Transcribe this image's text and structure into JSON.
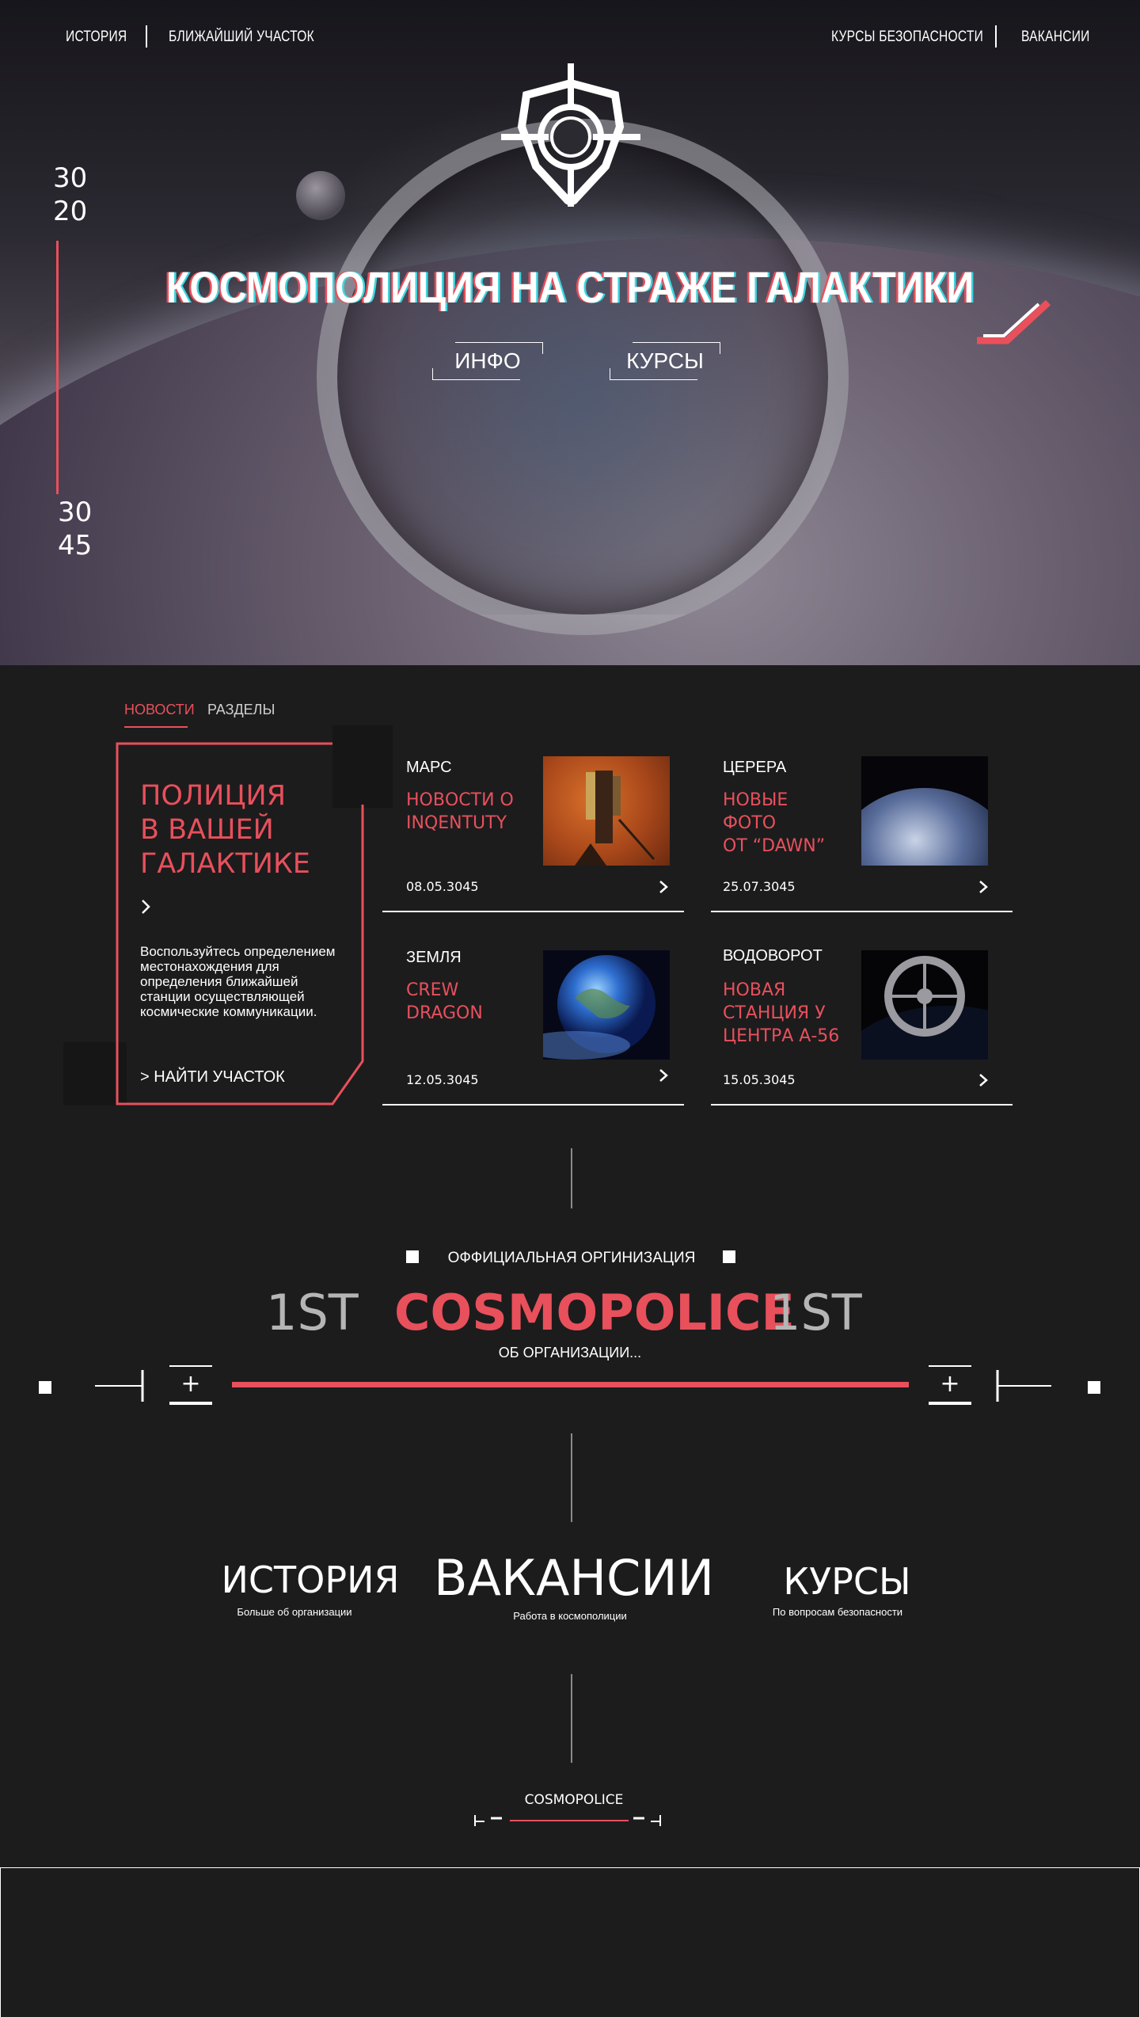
{
  "nav": {
    "left": [
      "ИСТОРИЯ",
      "БЛИЖАЙШИЙ УЧАСТОК"
    ],
    "right": [
      "КУРСЫ БЕЗОПАСНОСТИ",
      "ВАКАНСИИ"
    ]
  },
  "hero": {
    "title": "КОСМОПОЛИЦИЯ НА СТРАЖЕ ГАЛАКТИКИ",
    "buttons": [
      "ИНФО",
      "КУРСЫ"
    ],
    "year_top": [
      "30",
      "20"
    ],
    "year_bottom": [
      "30",
      "45"
    ]
  },
  "news": {
    "tabs": [
      "НОВОСТИ",
      "РАЗДЕЛЫ"
    ],
    "promo": {
      "title_lines": [
        "ПОЛИЦИЯ",
        "В ВАШЕЙ",
        "ГАЛАКТИКЕ"
      ],
      "text": "Воспользуйтесь определением местонахождения для определения ближайшей станции осуществляющей космические коммуникации.",
      "link": "> НАЙТИ УЧАСТОК"
    },
    "cards": [
      {
        "category": "МАРС",
        "title_lines": [
          "НОВОСТИ О",
          "INQENTUTY"
        ],
        "date": "08.05.3045",
        "image": "mars-rover-image"
      },
      {
        "category": "ЦЕРЕРА",
        "title_lines": [
          "НОВЫЕ ФОТО",
          "ОТ “DAWN”"
        ],
        "date": "25.07.3045",
        "image": "ceres-image"
      },
      {
        "category": "ЗЕМЛЯ",
        "title_lines": [
          "CREW",
          "DRAGON"
        ],
        "date": "12.05.3045",
        "image": "earth-image"
      },
      {
        "category": "ВОДОВОРОТ",
        "title_lines": [
          "НОВАЯ",
          "СТАНЦИЯ У",
          "ЦЕНТРА А-56"
        ],
        "date": "15.05.3045",
        "image": "space-station-image"
      }
    ]
  },
  "org": {
    "label": "ОФФИЦИАЛЬНАЯ ОРГИНИЗАЦИЯ",
    "left_word": "1ST",
    "main_word": "COSMOPOLICE",
    "right_word": "1ST",
    "sub_link": "ОБ ОРГАНИЗАЦИИ...",
    "plus": "+"
  },
  "links": [
    {
      "title": "ИСТОРИЯ",
      "sub": "Больше об организации"
    },
    {
      "title": "ВАКАНСИИ",
      "sub": "Работа в космополиции"
    },
    {
      "title": "КУРСЫ",
      "sub": "По вопросам безопасности"
    }
  ],
  "footer_logo": "COSMOPOLICE",
  "colors": {
    "accent": "#e8505b",
    "background": "#1c1c1d",
    "text": "#ffffff"
  }
}
